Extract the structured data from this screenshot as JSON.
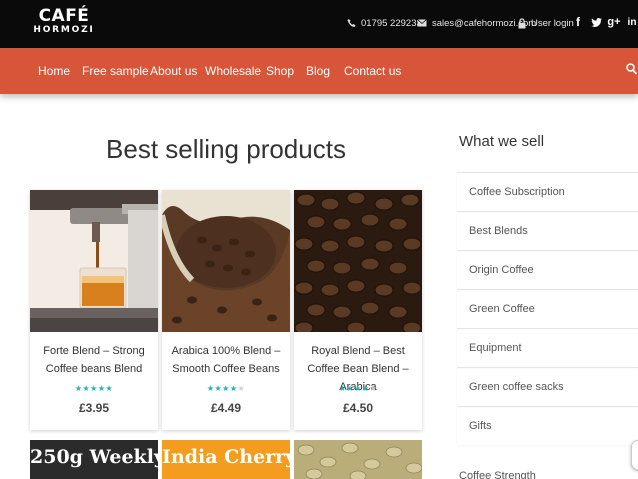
{
  "brand": {
    "line1": "CAFÉ",
    "line2": "HORMOZI"
  },
  "contact": {
    "phone": "01795 229233",
    "email": "sales@cafehormozi.com",
    "login": "User login"
  },
  "social": [
    {
      "icon": "facebook-icon",
      "glyph": "f"
    },
    {
      "icon": "twitter-icon",
      "glyph": "t"
    },
    {
      "icon": "google-plus-icon",
      "glyph": "g+"
    },
    {
      "icon": "linkedin-icon",
      "glyph": "in"
    }
  ],
  "nav": {
    "items": [
      "Home",
      "Free sample",
      "About us",
      "Wholesale",
      "Shop",
      "Blog",
      "Contact us"
    ],
    "search_icon": "search-icon"
  },
  "main": {
    "title": "Best selling products",
    "products": [
      {
        "name": "Forte Blend – Strong Coffee beans Blend",
        "price": "£3.95",
        "rating": 5
      },
      {
        "name": "Arabica 100% Blend – Smooth Coffee Beans",
        "price": "£4.49",
        "rating": 4
      },
      {
        "name": "Royal Blend – Best Coffee Bean Blend – Arabica",
        "price": "£4.50",
        "rating": 4
      }
    ],
    "banners": [
      {
        "text": "250g Weekly",
        "bg": "#2b2b2b",
        "color": "#ffffff"
      },
      {
        "text": "India Cherry",
        "bg": "#f39c1e",
        "color": "#ffffff"
      },
      {
        "text": "",
        "bg": "#c8bd8a",
        "color": "#ffffff"
      }
    ]
  },
  "sidebar": {
    "title": "What we sell",
    "items": [
      "Coffee Subscription",
      "Best Blends",
      "Origin Coffee",
      "Green Coffee",
      "Equipment",
      "Green coffee sacks",
      "Gifts"
    ],
    "next_heading": "Coffee Strength"
  },
  "colors": {
    "topbar": "#0a0a0a",
    "accent": "#d7563a",
    "star": "#1fb3b3"
  }
}
